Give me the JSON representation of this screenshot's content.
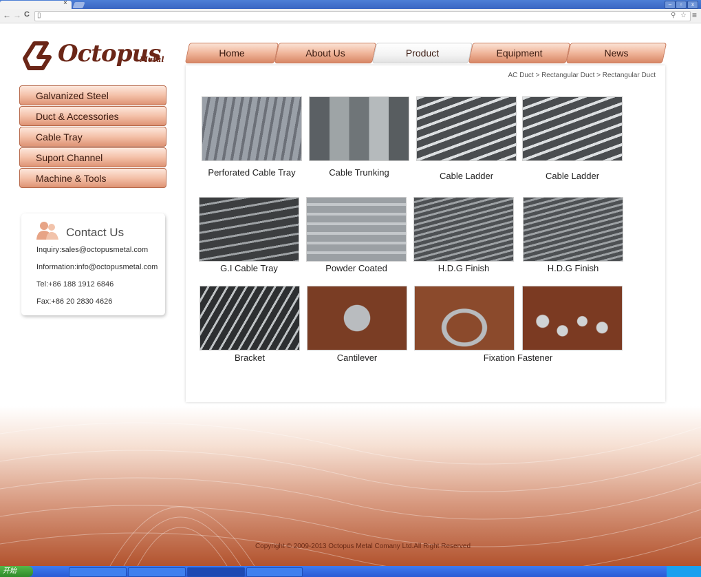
{
  "browser": {
    "tab_close": "×",
    "nav_back": "←",
    "nav_forward": "→",
    "nav_reload": "C",
    "win_min": "–",
    "win_max": "▫",
    "win_close": "x"
  },
  "logo": {
    "name": "Octopus",
    "sub": "Metal"
  },
  "topnav": [
    "Home",
    "About Us",
    "Product",
    "Equipment",
    "News"
  ],
  "breadcrumb": "AC Duct > Rectangular Duct > Rectangular Duct",
  "sidebar": [
    "Galvanized Steel",
    "Duct & Accessories",
    "Cable Tray",
    "Suport Channel",
    "Machine & Tools"
  ],
  "contact": {
    "title": "Contact Us",
    "lines": [
      "Inquiry:sales@octopusmetal.com",
      "Information:info@octopusmetal.com",
      "Tel:+86 188 1912 6846",
      "Fax:+86 20 2830 4626"
    ]
  },
  "products": [
    {
      "label": "Perforated Cable Tray"
    },
    {
      "label": "Cable Trunking"
    },
    {
      "label": "Cable Ladder"
    },
    {
      "label": "Cable Ladder"
    },
    {
      "label": "G.I Cable Tray"
    },
    {
      "label": "Powder Coated"
    },
    {
      "label": "H.D.G Finish"
    },
    {
      "label": "H.D.G Finish"
    },
    {
      "label": "Bracket"
    },
    {
      "label": "Cantilever"
    },
    {
      "label": "Fixation Fastener"
    }
  ],
  "footer": {
    "copyright": "Copyright © 2009-2013 Octopus Metal Comany Ltd.All Right Reserved"
  },
  "taskbar": {
    "start": "开始"
  },
  "colors": {
    "brand": "#6b2617",
    "accent": "#d88766"
  }
}
